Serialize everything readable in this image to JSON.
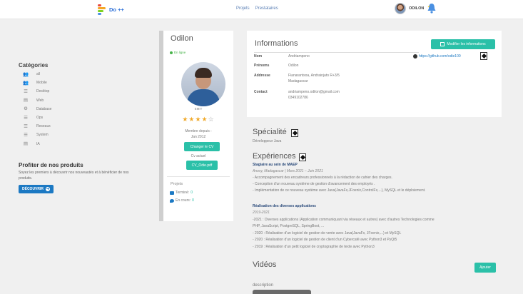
{
  "brand": {
    "name": "Do ++",
    "logo_colors": [
      "#e84a3c",
      "#f5a623",
      "#7ed321",
      "#4a90e2"
    ]
  },
  "nav": {
    "links": [
      "Projets",
      "Prestataires"
    ]
  },
  "user": {
    "name": "ODILON",
    "avatar_icon": "user-avatar",
    "notification_icon": "bell-icon"
  },
  "sidebar": {
    "title": "Catégories",
    "items": [
      {
        "label": "all",
        "icon": "users-icon"
      },
      {
        "label": "Mobile",
        "icon": "users-icon"
      },
      {
        "label": "Desktop",
        "icon": "server-icon"
      },
      {
        "label": "Web",
        "icon": "window-icon"
      },
      {
        "label": "Database",
        "icon": "settings-icon"
      },
      {
        "label": "Ops",
        "icon": "server-icon"
      },
      {
        "label": "Reseaux",
        "icon": "server-icon"
      },
      {
        "label": "System",
        "icon": "server-icon"
      },
      {
        "label": "IA",
        "icon": "window-icon"
      }
    ]
  },
  "promo": {
    "title": "Profiter de nos produits",
    "text": "Soyez les premiers à découvrir nos nouveautés et à bénéficier de nos produits.",
    "button": "DÉCOUVRIR"
  },
  "profile": {
    "name": "Odilon",
    "status": "En ligne",
    "school": "EMIT",
    "rating": "★★★★",
    "rating_empty": "☆",
    "member_label": "Membre depuis :",
    "member_since": "Jan 2012",
    "change_cv": "Changer le CV",
    "cv_label": "Cv actuel",
    "cv_file": "CV_Odie.pdf",
    "projects_title": "Projets",
    "done_label": "Terminé:",
    "done_count": "0",
    "ongoing_label": "En cours:",
    "ongoing_count": "0"
  },
  "info": {
    "title": "Informations",
    "edit_button": "Modifier les informations",
    "github": "https://github.com/odie100",
    "rows": [
      {
        "key": "Nom",
        "value": "Andriampeno"
      },
      {
        "key": "Prénoms",
        "value": "Odilon"
      },
      {
        "key": "Addresse",
        "value": "Fianarantsoa, Andrainjato R+3/5",
        "value2": "Madagascar"
      },
      {
        "key": "Contact",
        "value": "andriampeno.odilon@gmail.com",
        "value2": "0349102786"
      }
    ]
  },
  "specialty": {
    "title": "Spécialité",
    "value": "Développeur Java"
  },
  "experiences": {
    "title": "Expériences",
    "items": [
      {
        "head": "Stagiaire au sein de MAEP",
        "sub": "Anosy, Madagascar | Mars 2021 – Juin 2021",
        "lines": [
          "- Accompagnement des encadreurs professionnels à la rédaction de cahier des charges.",
          "- Conception d'un nouveau système de gestion d'avancement des employés .",
          "- Implémentation de ce nouveau système avec Java(JavaFx,JFoenix,ControlFx,...), MySQL et le déploiement."
        ]
      },
      {
        "head": "Réalisation des diverses applications",
        "sub": "2019-2021",
        "lines": [
          "-2021 : Diverses applications (Application communiquant via réseaux et      autres) avec d'autres Technologies comme",
          "PHP, JavaScript,        PostgreSQL, SpringBoot, ...",
          "- 2020 : Réalisation d'un logiciel de gestion de vente avec        Java(JavaFx, JFoenix,...) et MySQL",
          "- 2020 : Réalisation d'un logiciel de gestion de client d'un Cybercafé avec      Python3 et PyQt5",
          "- 2019 : Réalisation d'un petit logiciel de cryptographie de texte avec      Python3"
        ]
      }
    ]
  },
  "videos": {
    "title": "Vidéos",
    "add_button": "Ajouter",
    "description_label": "description"
  }
}
